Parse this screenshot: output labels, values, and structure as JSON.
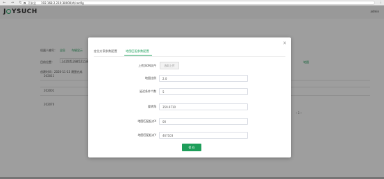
{
  "browser": {
    "nav_icons": "← → ↻",
    "insecure_label": "不安全",
    "url": "192.168.2.210:38000/#/config",
    "menu_icon": "⋮"
  },
  "app": {
    "logo_prefix": "J",
    "logo_suffix": "YSUCH",
    "user": "admin"
  },
  "background": {
    "breadcrumb_a": "机器人编号：",
    "breadcrumb_b": "全局",
    "breadcrumb_c": "车辆显示",
    "field_label": "目前位置：",
    "field_value": "1d1f0f1298f17154d",
    "trail_label": "地图",
    "time_text": "创建时间：2020-11-13  建图完成",
    "row1": "202011",
    "row2": "202001",
    "row3": "202070",
    "pager": "‹  1  ›"
  },
  "modal": {
    "close_icon": "×",
    "tabs": [
      {
        "label": "定位方案参数配置",
        "active": false
      },
      {
        "label": "地图匹配参数配置",
        "active": true
      }
    ],
    "upload": {
      "label": "上传JSON文件",
      "button": "选取上传"
    },
    "fields": [
      {
        "label": "地图比例",
        "value": "2.0"
      },
      {
        "label": "延迟条件个数",
        "value": "5"
      },
      {
        "label": "旋转角",
        "value": "359.9710"
      },
      {
        "label": "地图匹配起点X",
        "value": "00"
      },
      {
        "label": "地图匹配起点Y",
        "value": "467103"
      }
    ],
    "save_label": "保 存"
  },
  "colors": {
    "accent": "#1e9e5a",
    "overlay": "rgba(0,0,0,0.38)"
  }
}
